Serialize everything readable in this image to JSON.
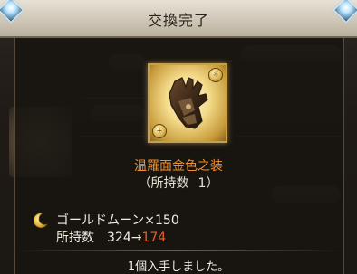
{
  "header": {
    "title": "交換完了"
  },
  "item": {
    "name": "温羅面金色之装",
    "owned_label": "（所持数",
    "owned_count": "1）",
    "icon": "gauntlet-icon"
  },
  "cost": {
    "currency_icon": "moon-icon",
    "text": "ゴールドムーン×150",
    "stock_label": "所持数",
    "stock_before": "324",
    "arrow": "→",
    "stock_after": "174"
  },
  "message": "1個入手しました。",
  "colors": {
    "item_name": "#ee8f33",
    "stock_after": "#ee5a2a",
    "header_bg": "#d6cfc0"
  }
}
